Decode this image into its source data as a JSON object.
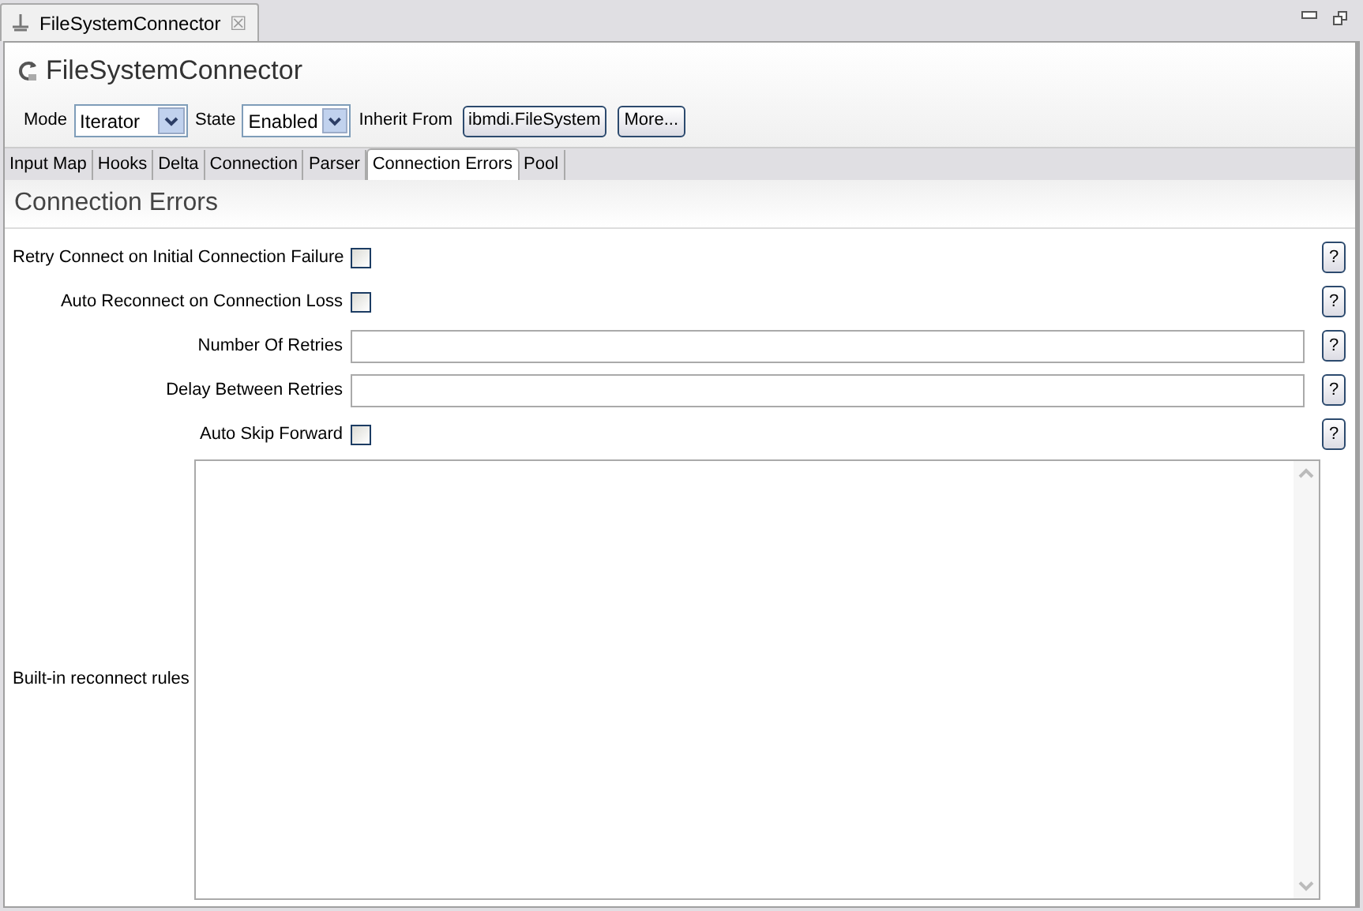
{
  "editor_tab": {
    "title": "FileSystemConnector",
    "close": "☒"
  },
  "title": "FileSystemConnector",
  "toolbar": {
    "mode_label": "Mode",
    "mode_value": "Iterator",
    "state_label": "State",
    "state_value": "Enabled",
    "inherit_label": "Inherit From",
    "inherit_button": "ibmdi.FileSystem",
    "more_button": "More..."
  },
  "tabs": [
    {
      "label": "Input Map",
      "selected": false
    },
    {
      "label": "Hooks",
      "selected": false
    },
    {
      "label": "Delta",
      "selected": false
    },
    {
      "label": "Connection",
      "selected": false
    },
    {
      "label": "Parser",
      "selected": false
    },
    {
      "label": "Connection Errors",
      "selected": true
    },
    {
      "label": "Pool",
      "selected": false
    }
  ],
  "section_title": "Connection Errors",
  "fields": [
    {
      "kind": "checkbox",
      "label": "Retry Connect on Initial Connection Failure",
      "checked": false,
      "help": "?"
    },
    {
      "kind": "checkbox",
      "label": "Auto Reconnect on Connection Loss",
      "checked": false,
      "help": "?"
    },
    {
      "kind": "text",
      "label": "Number Of Retries",
      "help": "?"
    },
    {
      "kind": "text",
      "label": "Delay Between Retries",
      "help": "?"
    },
    {
      "kind": "checkbox",
      "label": "Auto Skip Forward",
      "checked": false,
      "help": "?"
    }
  ],
  "rules": {
    "label": "Built-in reconnect rules"
  }
}
